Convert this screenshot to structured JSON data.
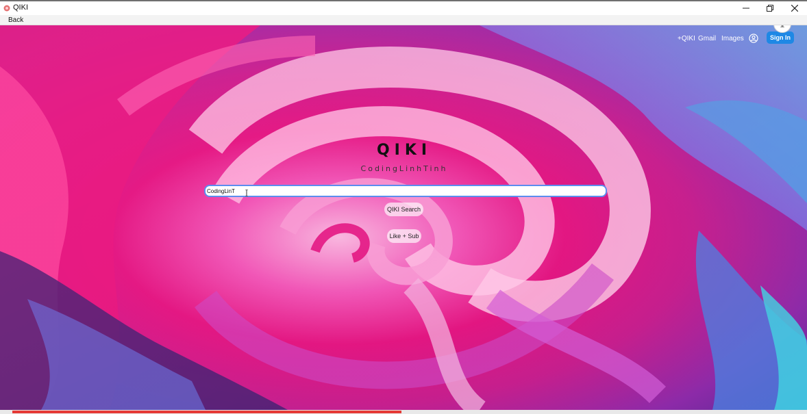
{
  "window": {
    "title": "QIKI",
    "back_label": "Back"
  },
  "nav": {
    "qiki_link": "+QIKI",
    "gmail_link": "Gmail",
    "images_link": "Images",
    "sign_in": "Sign In",
    "info": "i"
  },
  "main": {
    "logo": "QIKI",
    "subtitle": "CodingLinhTinh",
    "search_value": "CodingLinT",
    "search_button": "QIKI Search",
    "like_button": "Like + Sub"
  },
  "video_progress": 0.49,
  "colors": {
    "sign_in_bg": "#1e88e5",
    "search_border": "#5b8def",
    "progress": "#e53935"
  }
}
